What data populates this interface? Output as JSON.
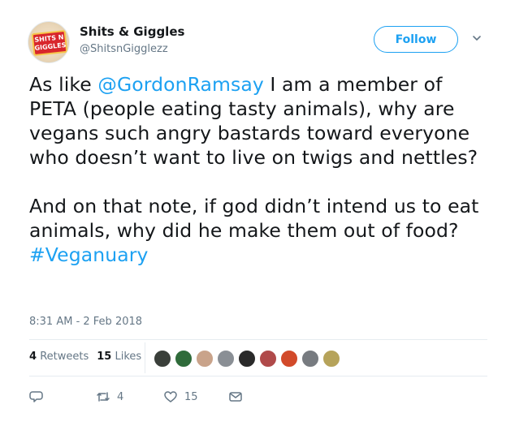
{
  "user": {
    "display_name": "Shits & Giggles",
    "handle": "@ShitsnGigglezz",
    "avatar_text": "SHITS N GIGGLES"
  },
  "follow_label": "Follow",
  "tweet": {
    "prefix": "As like ",
    "mention": "@GordonRamsay",
    "middle": " I am a member of PETA (people eating tasty animals), why are vegans such angry bastards toward everyone who doesn’t want to live on twigs and nettles?\n\nAnd on that note, if god didn’t intend us to eat animals, why did he make them out of food? ",
    "hashtag": "#Veganuary"
  },
  "timestamp": "8:31 AM - 2 Feb 2018",
  "stats": {
    "retweets_count": "4",
    "retweets_label": "Retweets",
    "likes_count": "15",
    "likes_label": "Likes"
  },
  "liker_colors": [
    "#3a3f3a",
    "#2f6b3a",
    "#c9a38a",
    "#8a8f95",
    "#2a2a2a",
    "#b04a4a",
    "#d24a2a",
    "#777b80",
    "#b6a35a"
  ],
  "actions": {
    "reply_count": "",
    "retweet_count": "4",
    "like_count": "15"
  }
}
